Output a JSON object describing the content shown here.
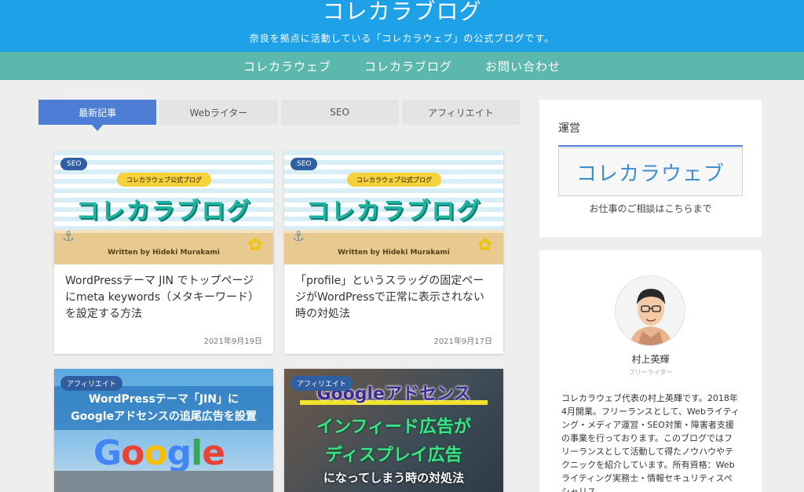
{
  "header": {
    "title": "コレカラブログ",
    "description": "奈良を拠点に活動している「コレカラウェブ」の公式ブログです。"
  },
  "nav": {
    "items": [
      "コレカラウェブ",
      "コレカラブログ",
      "お問い合わせ"
    ]
  },
  "tabs": {
    "items": [
      "最新記事",
      "Webライター",
      "SEO",
      "アフィリエイト"
    ],
    "active": "最新記事"
  },
  "posts": [
    {
      "category": "SEO",
      "thumbnail_pill": "コレカラウェブ公式ブログ",
      "thumbnail_title": "コレカラブログ",
      "thumbnail_byline": "Written by Hideki Murakami",
      "title": "WordPressテーマ JIN でトップページにmeta keywords（メタキーワード）を設定する方法",
      "date": "2021年9月19日"
    },
    {
      "category": "SEO",
      "thumbnail_pill": "コレカラウェブ公式ブログ",
      "thumbnail_title": "コレカラブログ",
      "thumbnail_byline": "Written by Hideki Murakami",
      "title": "「profile」というスラッグの固定ページがWordPressで正常に表示されない時の対処法",
      "date": "2021年9月17日"
    },
    {
      "category": "アフィリエイト",
      "thumbnail_line1": "WordPressテーマ「JIN」に",
      "thumbnail_line2": "Googleアドセンスの追尾広告を設置",
      "thumbnail_logo": "Google"
    },
    {
      "category": "アフィリエイト",
      "thumbnail_line1": "Googleアドセンス",
      "thumbnail_line2": "インフィード広告が",
      "thumbnail_line3": "ディスプレイ広告",
      "thumbnail_line4": "になってしまう時の対処法"
    }
  ],
  "sidebar": {
    "operator": {
      "title": "運営",
      "banner_text": "コレカラウェブ",
      "caption": "お仕事のご相談はこちらまで"
    },
    "profile": {
      "name": "村上英輝",
      "role": "フリーライター",
      "text": "コレカラウェブ代表の村上英輝です。2018年4月開業。フリーランスとして、Webライティング・メディア運営・SEO対策・障害者支援の事業を行っております。このブログではフリーランスとして活動して得たノウハウやテクニックを紹介しています。所有資格：Webライティング実務士・情報セキュリティスペシャリス"
    }
  },
  "colors": {
    "header": "#1fa1e8",
    "nav": "#5cb8ad",
    "active_tab": "#4c7ed6",
    "badge": "#2f5fa0"
  }
}
